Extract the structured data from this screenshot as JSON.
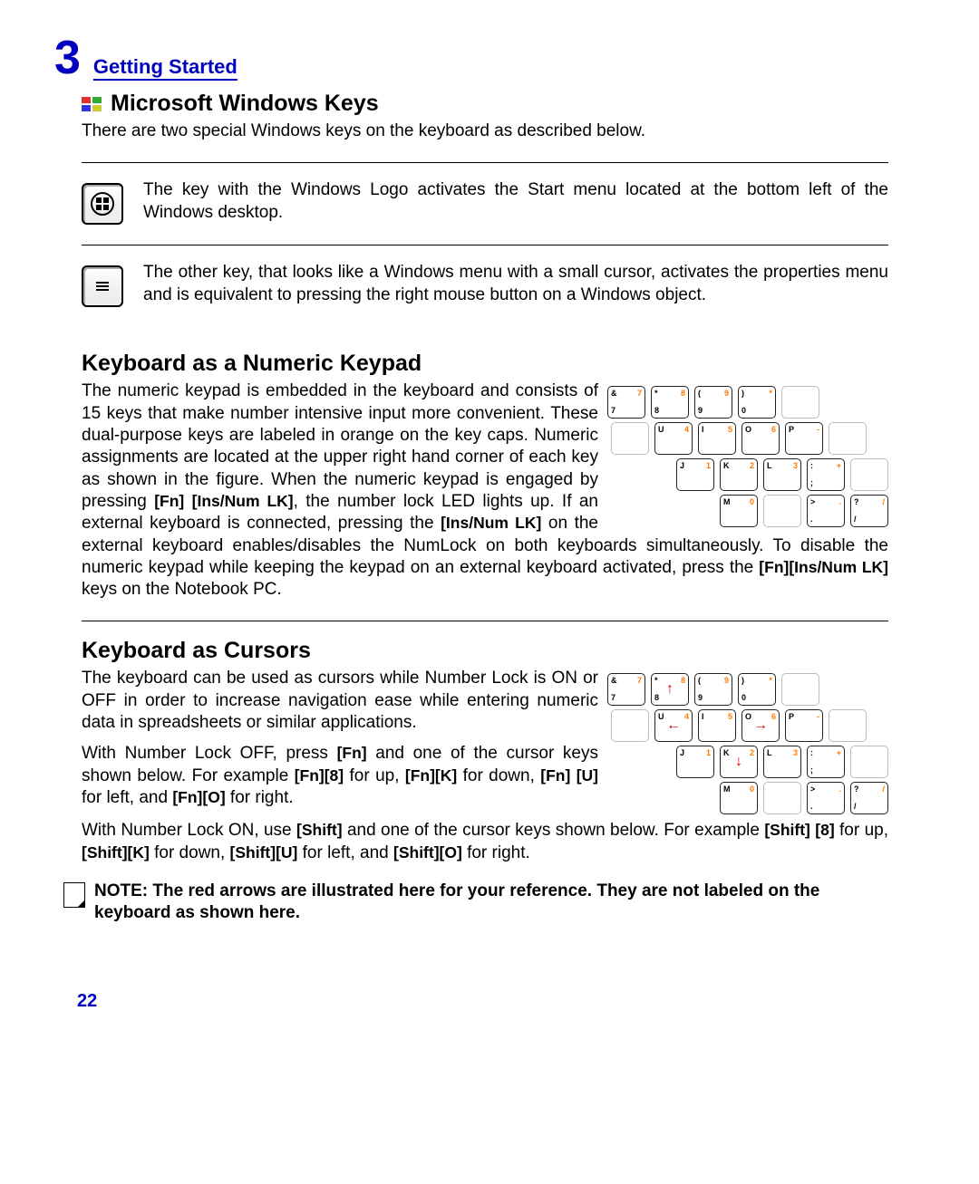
{
  "header": {
    "chapter_num": "3",
    "chapter_title": "Getting Started"
  },
  "section1": {
    "title": "Microsoft Windows Keys",
    "intro": "There are two special Windows keys on the keyboard as described below.",
    "item1": "The key with the Windows Logo activates the Start menu located at the bottom left of the Windows desktop.",
    "item2": "The other key, that looks like a Windows menu with a small cursor, activates the properties menu and is equivalent to pressing the right mouse button on a Windows object."
  },
  "section2": {
    "title": "Keyboard as a Numeric Keypad",
    "para_a": "The numeric keypad is embedded in the keyboard and consists of 15 keys that make number intensive input more convenient. These dual-purpose keys are labeled in orange on the key caps. Numeric assignments are located at the upper right hand corner of each key as shown in the figure. When the numeric keypad is engaged by pressing ",
    "k1": "[Fn]",
    "k2": "[Ins/Num LK]",
    "para_b": ", the number lock LED lights up. If an external keyboard is connected, pressing the ",
    "k3": "[Ins/Num LK]",
    "para_c": " on the external keyboard enables/disables the NumLock on both keyboards simultaneously. To disable the numeric keypad while keeping the keypad on an external keyboard activated, press the  ",
    "k4": "[Fn][Ins/Num LK]",
    "para_d": " keys on the Notebook PC."
  },
  "section3": {
    "title": "Keyboard as Cursors",
    "p1": "The keyboard can be used as cursors while Number Lock is ON or OFF in order to increase navigation ease while entering numeric data in spreadsheets or similar applications.",
    "p2_a": "With Number Lock OFF, press ",
    "p2_k1": "[Fn]",
    "p2_b": " and one of the cursor keys shown below. For example ",
    "p2_k2": "[Fn][8]",
    "p2_c": " for up, ",
    "p2_k3": "[Fn][K]",
    "p2_d": " for down, ",
    "p2_k4": "[Fn]",
    "p2_e": "[U]",
    "p2_f": " for left, and ",
    "p2_k5": "[Fn][O]",
    "p2_g": " for right.",
    "p3_a": "With Number Lock ON, use ",
    "p3_k1": "[Shift]",
    "p3_b": " and one of the cursor keys shown below. For example ",
    "p3_k2": "[Shift]",
    "p3_c": "[8]",
    "p3_d": " for up, ",
    "p3_k3": "[Shift][K]",
    "p3_e": " for down, ",
    "p3_k4": "[Shift][U]",
    "p3_f": " for left, and ",
    "p3_k5": "[Shift][O]",
    "p3_g": " for right."
  },
  "note": "NOTE: The red arrows are illustrated here for your reference. They are not labeled on the keyboard as shown here.",
  "page_number": "22",
  "keypad1": {
    "rows": [
      [
        {
          "tl": "&",
          "tr": "7",
          "bl": "7"
        },
        {
          "tl": "*",
          "tr": "8",
          "bl": "8"
        },
        {
          "tl": "(",
          "tr": "9",
          "bl": "9"
        },
        {
          "tl": ")",
          "tr": "*",
          "bl": "0"
        },
        {
          "light": true
        }
      ],
      [
        {
          "light": true
        },
        {
          "tl": "U",
          "tr": "4",
          "bl": ""
        },
        {
          "tl": "I",
          "tr": "5",
          "bl": ""
        },
        {
          "tl": "O",
          "tr": "6",
          "bl": ""
        },
        {
          "tl": "P",
          "tr": "-",
          "bl": ""
        },
        {
          "light": true
        }
      ],
      [
        {
          "hidden": true
        },
        {
          "tl": "J",
          "tr": "1",
          "bl": ""
        },
        {
          "tl": "K",
          "tr": "2",
          "bl": ""
        },
        {
          "tl": "L",
          "tr": "3",
          "bl": ""
        },
        {
          "tl": ":",
          "tr": "+",
          "bl": ";"
        },
        {
          "light": true
        }
      ],
      [
        {
          "hidden": true
        },
        {
          "hidden": true
        },
        {
          "tl": "M",
          "tr": "0",
          "bl": ""
        },
        {
          "light": true
        },
        {
          "tl": ">",
          "tr": ".",
          "bl": "."
        },
        {
          "tl": "?",
          "tr": "/",
          "bl": "/"
        }
      ]
    ]
  },
  "keypad2": {
    "rows": [
      [
        {
          "tl": "&",
          "tr": "7",
          "bl": "7"
        },
        {
          "tl": "*",
          "tr": "8",
          "bl": "8",
          "arrow": "↑"
        },
        {
          "tl": "(",
          "tr": "9",
          "bl": "9"
        },
        {
          "tl": ")",
          "tr": "*",
          "bl": "0"
        },
        {
          "light": true
        }
      ],
      [
        {
          "light": true
        },
        {
          "tl": "U",
          "tr": "4",
          "bl": "",
          "arrow": "←"
        },
        {
          "tl": "I",
          "tr": "5",
          "bl": ""
        },
        {
          "tl": "O",
          "tr": "6",
          "bl": "",
          "arrow": "→"
        },
        {
          "tl": "P",
          "tr": "-",
          "bl": ""
        },
        {
          "light": true
        }
      ],
      [
        {
          "hidden": true
        },
        {
          "tl": "J",
          "tr": "1",
          "bl": ""
        },
        {
          "tl": "K",
          "tr": "2",
          "bl": "",
          "arrow": "↓"
        },
        {
          "tl": "L",
          "tr": "3",
          "bl": ""
        },
        {
          "tl": ":",
          "tr": "+",
          "bl": ";"
        },
        {
          "light": true
        }
      ],
      [
        {
          "hidden": true
        },
        {
          "hidden": true
        },
        {
          "tl": "M",
          "tr": "0",
          "bl": ""
        },
        {
          "light": true
        },
        {
          "tl": ">",
          "tr": ".",
          "bl": "."
        },
        {
          "tl": "?",
          "tr": "/",
          "bl": "/"
        }
      ]
    ]
  }
}
